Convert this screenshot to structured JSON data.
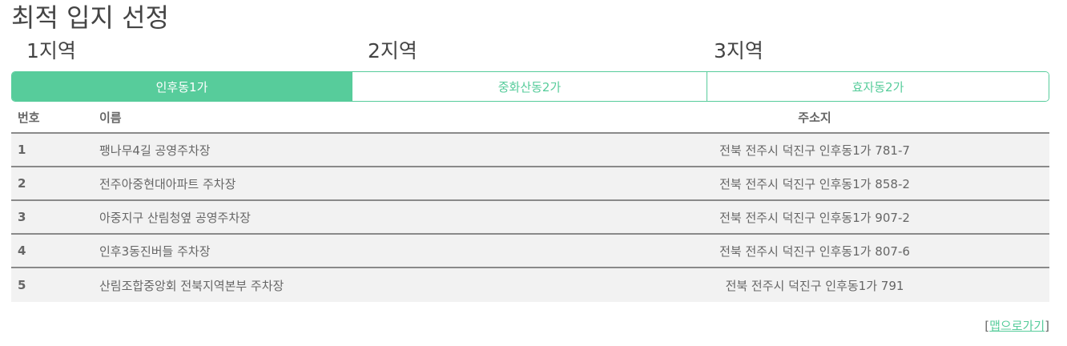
{
  "page": {
    "title": "최적 입지 선정"
  },
  "regions": [
    {
      "label": "1지역"
    },
    {
      "label": "2지역"
    },
    {
      "label": "3지역"
    }
  ],
  "tabs": [
    {
      "label": "인후동1가",
      "active": true
    },
    {
      "label": "중화산동2가",
      "active": false
    },
    {
      "label": "효자동2가",
      "active": false
    }
  ],
  "table": {
    "headers": {
      "no": "번호",
      "name": "이름",
      "address": "주소지"
    },
    "rows": [
      {
        "no": "1",
        "name": "팽나무4길 공영주차장",
        "address": "전북 전주시 덕진구 인후동1가 781-7"
      },
      {
        "no": "2",
        "name": "전주아중현대아파트 주차장",
        "address": "전북 전주시 덕진구 인후동1가 858-2"
      },
      {
        "no": "3",
        "name": "아중지구 산림청옆 공영주차장",
        "address": "전북 전주시 덕진구 인후동1가 907-2"
      },
      {
        "no": "4",
        "name": "인후3동진버들 주차장",
        "address": "전북 전주시 덕진구 인후동1가 807-6"
      },
      {
        "no": "5",
        "name": "산림조합중앙회 전북지역본부 주차장",
        "address": "전북 전주시 덕진구 인후동1가 791"
      }
    ]
  },
  "footer": {
    "bracket_open": "[",
    "map_link": "맵으로가기",
    "bracket_close": "]"
  },
  "colors": {
    "accent": "#57cc9b",
    "row_bg": "#f2f2f2",
    "divider": "#8a8a8a"
  }
}
